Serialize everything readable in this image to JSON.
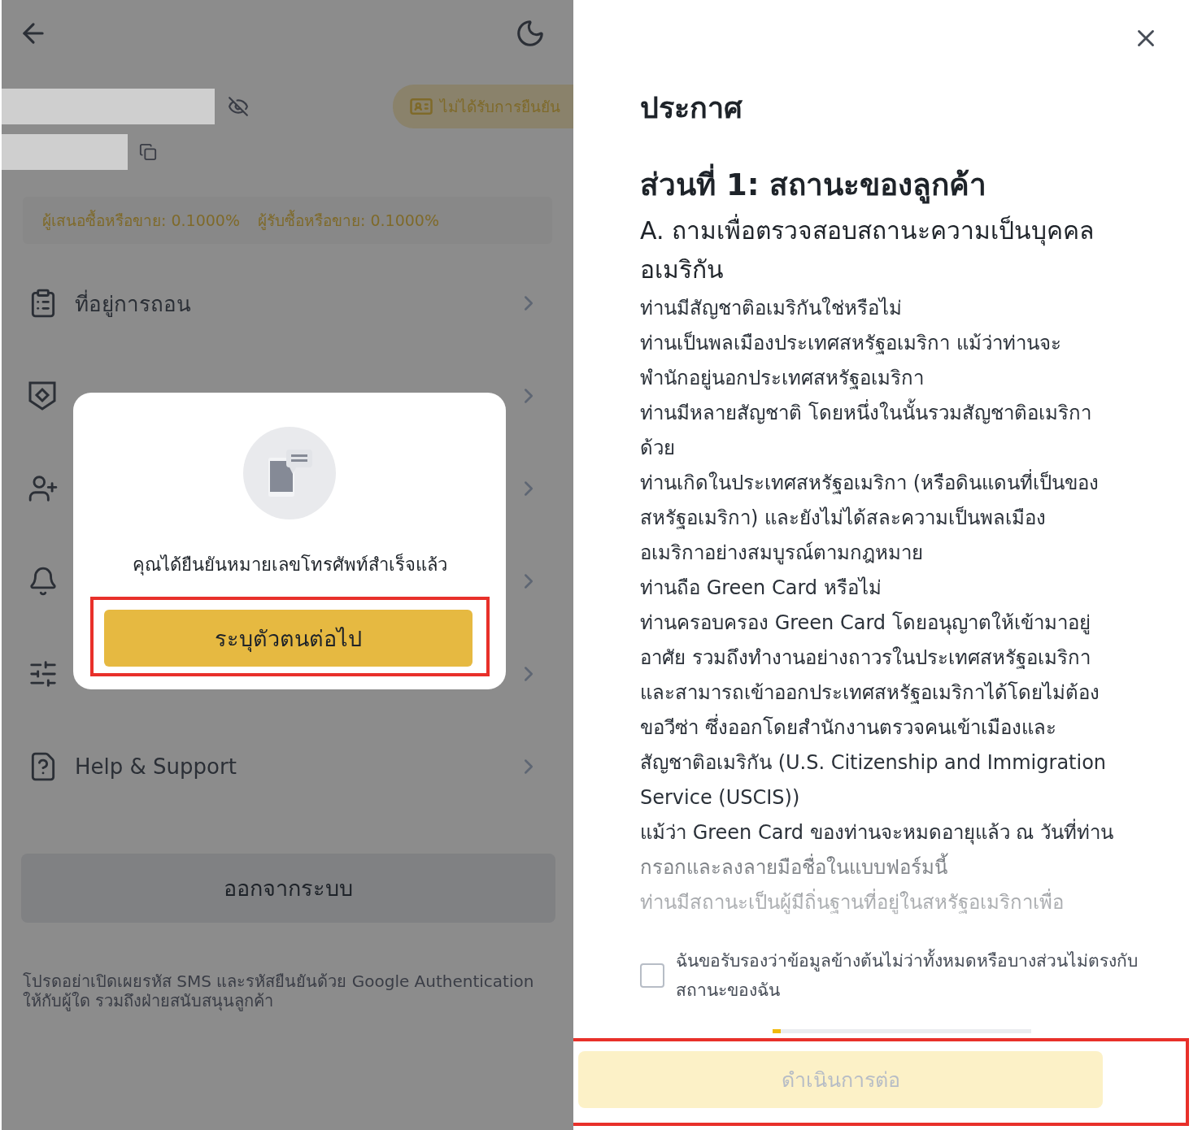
{
  "profile_screen": {
    "verification_badge": "ไม่ได้รับการยืนยัน",
    "fees": [
      "ผู้เสนอซื้อหรือขาย: 0.1000%",
      "ผู้รับซื้อหรือขาย: 0.1000%"
    ],
    "menu_items": [
      {
        "label": "ที่อยู่การถอน"
      },
      {
        "label": "Help & Support"
      }
    ],
    "logout_button": "ออกจากระบบ",
    "warning": "โปรดอย่าเปิดเผยรหัส SMS และรหัสยืนยันด้วย Google Authentication ให้กับผู้ใด รวมถึงฝ่ายสนับสนุนลูกค้า",
    "dialog": {
      "message": "คุณได้ยืนยันหมายเลขโทรศัพท์สำเร็จแล้ว",
      "button": "ระบุตัวตนต่อไป",
      "highlighted": true
    }
  },
  "notice_screen": {
    "title": "ประกาศ",
    "heading": "ส่วนที่ 1: สถานะของลูกค้า",
    "subheading": [
      "A. ถามเพื่อตรวจสอบสถานะความเป็นบุคคล",
      "อเมริกัน"
    ],
    "paragraphs": [
      {
        "lines": [
          "ท่านมีสัญชาติอเมริกันใช่หรือไม่"
        ]
      },
      {
        "lines": [
          "ท่านเป็นพลเมืองประเทศสหรัฐอเมริกา แม้ว่าท่านจะ",
          "พำนักอยู่นอกประเทศสหรัฐอเมริกา"
        ]
      },
      {
        "lines": [
          "ท่านมีหลายสัญชาติ โดยหนึ่งในนั้นรวมสัญชาติอเมริกา",
          "ด้วย"
        ]
      },
      {
        "lines": [
          "ท่านเกิดในประเทศสหรัฐอเมริกา (หรือดินแดนที่เป็นของ",
          "สหรัฐอเมริกา) และยังไม่ได้สละความเป็นพลเมือง",
          "อเมริกาอย่างสมบูรณ์ตามกฎหมาย"
        ]
      },
      {
        "lines": [
          "ท่านถือ Green Card หรือไม่"
        ]
      },
      {
        "lines": [
          "ท่านครอบครอง Green Card โดยอนุญาตให้เข้ามาอยู่",
          "อาศัย รวมถึงทำงานอย่างถาวรในประเทศสหรัฐอเมริกา",
          "และสามารถเข้าออกประเทศสหรัฐอเมริกาได้โดยไม่ต้อง",
          "ขอวีซ่า ซึ่งออกโดยสำนักงานตรวจคนเข้าเมืองและ",
          "สัญชาติอเมริกัน (U.S. Citizenship and Immigration",
          "Service (USCIS))"
        ]
      },
      {
        "lines": [
          "แม้ว่า Green Card ของท่านจะหมดอายุแล้ว ณ วันที่ท่าน",
          "กรอกและลงลายมือชื่อในแบบฟอร์มนี้"
        ]
      },
      {
        "lines": [
          "ท่านมีสถานะเป็นผู้มีถิ่นฐานที่อยู่ในสหรัฐอเมริกาเพื่อ"
        ]
      }
    ],
    "consent": {
      "label": "ฉันขอรับรองว่าข้อมูลข้างต้นไม่ว่าทั้งหมดหรือบางส่วนไม่ตรงกับสถานะของฉัน",
      "checked": false
    },
    "progress": {
      "level": 0.03
    },
    "continue_button": {
      "label": "ดำเนินการต่อ",
      "disabled": true,
      "highlighted": true
    }
  }
}
